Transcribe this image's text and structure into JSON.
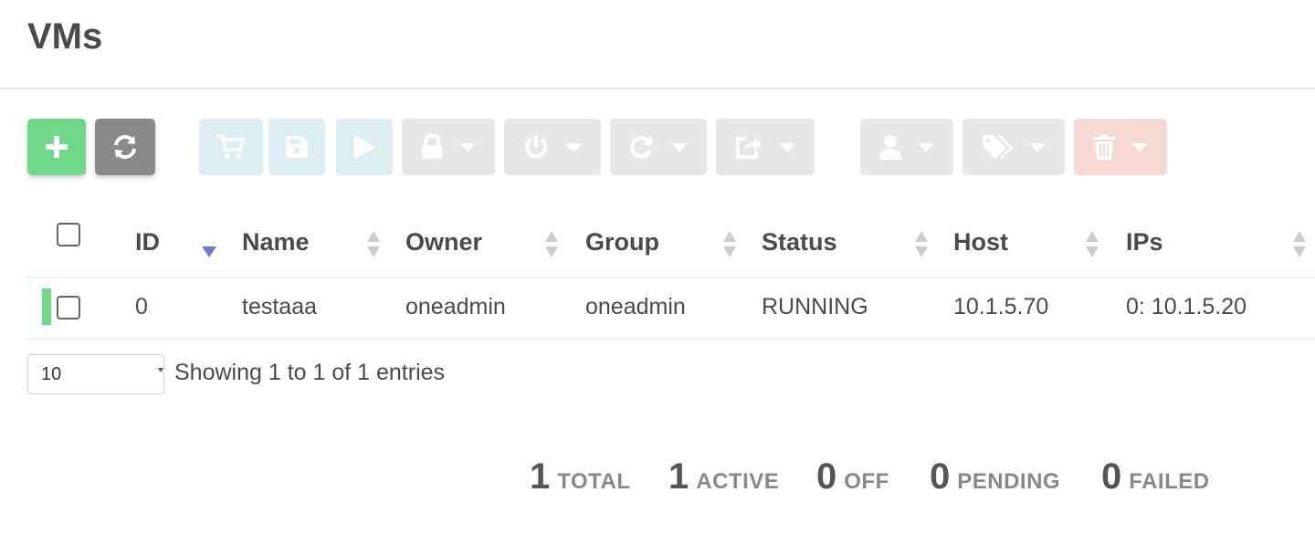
{
  "header": {
    "title": "VMs"
  },
  "toolbar": {
    "buttons": [
      {
        "name": "create",
        "icon": "plus-icon"
      },
      {
        "name": "refresh",
        "icon": "refresh-icon"
      },
      {
        "name": "marketplace",
        "icon": "cart-icon"
      },
      {
        "name": "save",
        "icon": "save-icon"
      },
      {
        "name": "deploy",
        "icon": "play-icon"
      },
      {
        "name": "lock",
        "icon": "lock-icon"
      },
      {
        "name": "power",
        "icon": "power-icon"
      },
      {
        "name": "reboot",
        "icon": "redo-icon"
      },
      {
        "name": "migrate",
        "icon": "share-icon"
      },
      {
        "name": "user",
        "icon": "user-icon"
      },
      {
        "name": "labels",
        "icon": "tags-icon"
      },
      {
        "name": "delete",
        "icon": "trash-icon"
      }
    ]
  },
  "table": {
    "columns": [
      "ID",
      "Name",
      "Owner",
      "Group",
      "Status",
      "Host",
      "IPs"
    ],
    "rows": [
      {
        "id": "0",
        "name": "testaaa",
        "owner": "oneadmin",
        "group": "oneadmin",
        "status": "RUNNING",
        "host": "10.1.5.70",
        "ips": "0: 10.1.5.20",
        "state_color": "#6fd98a"
      }
    ]
  },
  "pagination": {
    "length_selected": "10",
    "info": "Showing 1 to 1 of 1 entries"
  },
  "summary": [
    {
      "count": "1",
      "label": "TOTAL"
    },
    {
      "count": "1",
      "label": "ACTIVE"
    },
    {
      "count": "0",
      "label": "OFF"
    },
    {
      "count": "0",
      "label": "PENDING"
    },
    {
      "count": "0",
      "label": "FAILED"
    }
  ],
  "colors": {
    "create": "#6fd98a",
    "refresh": "#8a8a8a",
    "info_button": "#dcedf4",
    "secondary_button": "#e7e7e7",
    "alert_button": "#f6d8d3",
    "sort_active": "#6f7bd3"
  }
}
